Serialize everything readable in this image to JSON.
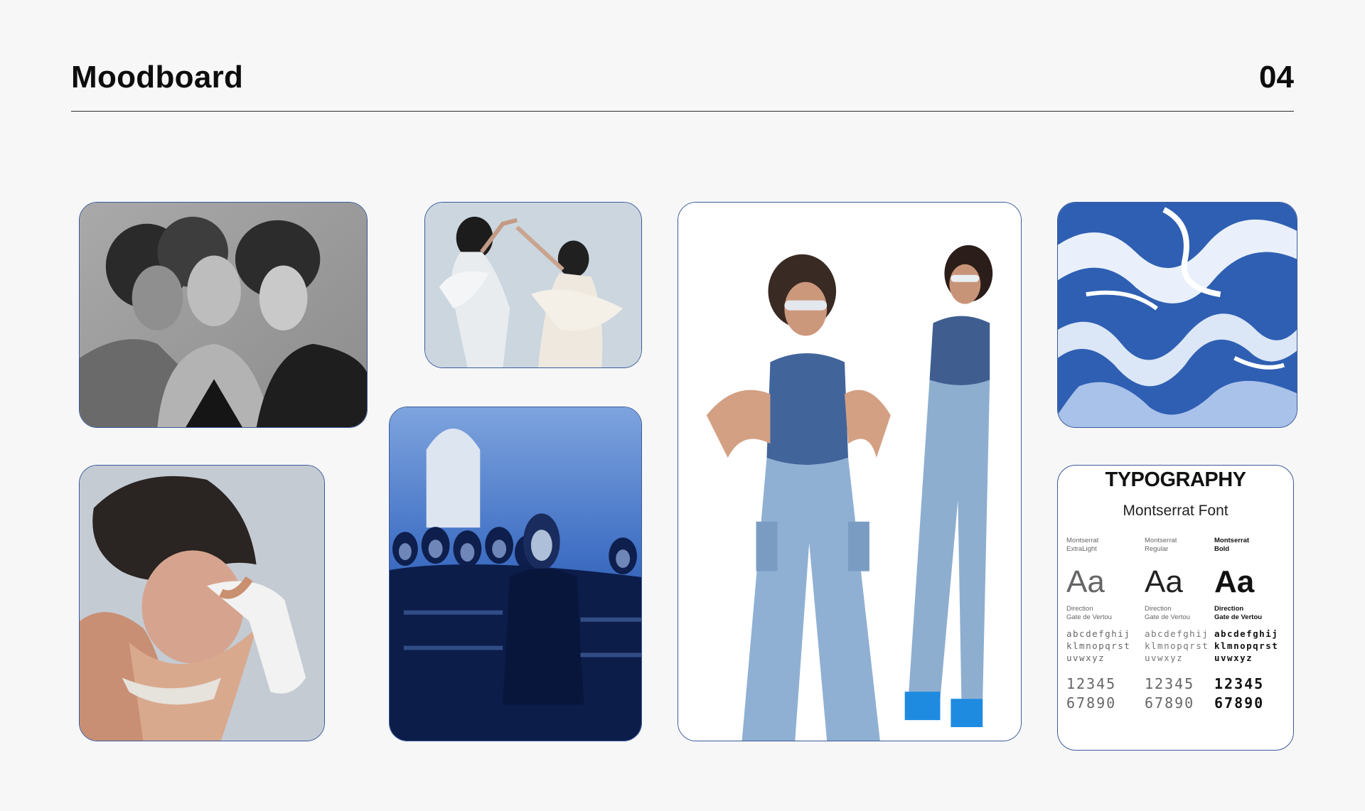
{
  "header": {
    "title": "Moodboard",
    "page_number": "04"
  },
  "accent_color": "#2f5fb3",
  "images": [
    {
      "name": "three-women-bw-photo"
    },
    {
      "name": "two-dancers-photo"
    },
    {
      "name": "woman-pose-photo"
    },
    {
      "name": "church-scene-blue-photo"
    },
    {
      "name": "two-models-denim-photo"
    },
    {
      "name": "blue-liquid-texture"
    }
  ],
  "typography": {
    "title": "TYPOGRAPHY",
    "subtitle": "Montserrat Font",
    "columns": [
      {
        "name": "Montserrat\nExtraLight",
        "sample": "Aa",
        "direction": "Direction\nGate de Vertou",
        "alphabet": "abcdefghij\nklmnopqrst\nuvwxyz",
        "numbers": "12345\n67890"
      },
      {
        "name": "Montserrat\nRegular",
        "sample": "Aa",
        "direction": "Direction\nGate de Vertou",
        "alphabet": "abcdefghij\nklmnopqrst\nuvwxyz",
        "numbers": "12345\n67890"
      },
      {
        "name": "Montserrat\nBold",
        "sample": "Aa",
        "direction": "Direction\nGate de Vertou",
        "alphabet": "abcdefghij\nklmnopqrst\nuvwxyz",
        "numbers": "12345\n67890"
      }
    ]
  }
}
